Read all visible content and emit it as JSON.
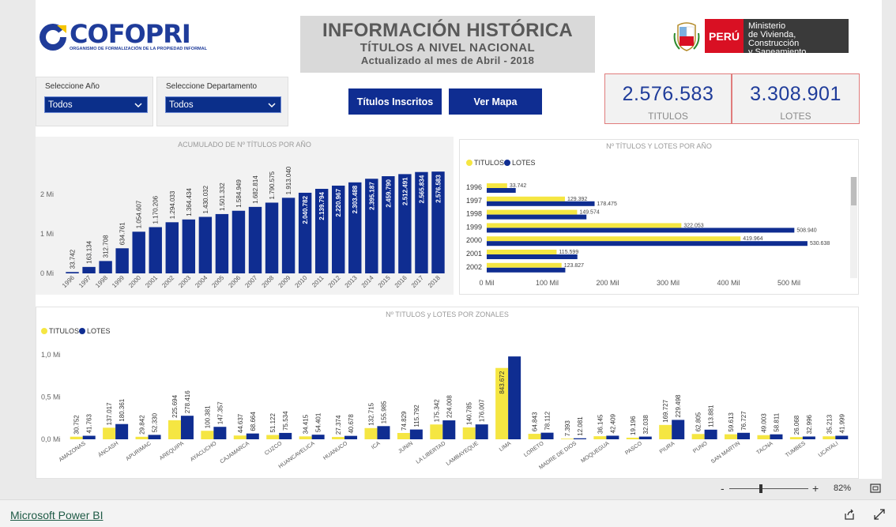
{
  "header": {
    "logo_brand": "COFOPRI",
    "logo_sub": "ORGANISMO DE FORMALIZACIÓN DE LA PROPIEDAD INFORMAL",
    "title_main": "INFORMACIÓN HISTÓRICA",
    "title_sub": "TÍTULOS A NIVEL NACIONAL",
    "title_date": "Actualizado al mes de Abril - 2018",
    "peru_label": "PERÚ",
    "ministry_line1": "Ministerio",
    "ministry_line2": "de Vivienda, Construcción",
    "ministry_line3": "y Saneamiento"
  },
  "filters": {
    "year_label": "Seleccione Año",
    "year_value": "Todos",
    "dept_label": "Seleccione Departamento",
    "dept_value": "Todos"
  },
  "buttons": {
    "titulos_inscritos": "Títulos Inscritos",
    "ver_mapa": "Ver Mapa"
  },
  "kpis": {
    "titulos_value": "2.576.583",
    "titulos_caption": "TITULOS",
    "lotes_value": "3.308.901",
    "lotes_caption": "LOTES"
  },
  "colors": {
    "navy": "#0f2d91",
    "yellow": "#f5e642",
    "kpi_border": "#e07c7c"
  },
  "zoom": {
    "minus": "-",
    "plus": "+",
    "level": "82%",
    "level_fraction": 0.4
  },
  "footer": {
    "powerbi_link": "Microsoft Power BI"
  },
  "chart_data": [
    {
      "type": "bar",
      "title": "ACUMULADO DE Nº TÍTULOS POR AÑO",
      "categories": [
        "1996",
        "1997",
        "1998",
        "1999",
        "2000",
        "2001",
        "2002",
        "2003",
        "2004",
        "2005",
        "2006",
        "2007",
        "2008",
        "2009",
        "2010",
        "2011",
        "2012",
        "2013",
        "2014",
        "2015",
        "2016",
        "2017",
        "2018"
      ],
      "values": [
        33742,
        163134,
        312708,
        634761,
        1054607,
        1170206,
        1294033,
        1364434,
        1430032,
        1501332,
        1584949,
        1682814,
        1790575,
        1913040,
        2040782,
        2139794,
        2220967,
        2303488,
        2395187,
        2459790,
        2512491,
        2565834,
        2576583
      ],
      "labels": [
        "33.742",
        "163.134",
        "312.708",
        "634.761",
        "1.054.607",
        "1.170.206",
        "1.294.033",
        "1.364.434",
        "1.430.032",
        "1.501.332",
        "1.584.949",
        "1.682.814",
        "1.790.575",
        "1.913.040",
        "2.040.782",
        "2.139.794",
        "2.220.967",
        "2.303.488",
        "2.395.187",
        "2.459.790",
        "2.512.491",
        "2.565.834",
        "2.576.583"
      ],
      "yticks": [
        "0 Mi",
        "1 Mi",
        "2 Mi"
      ],
      "ylim": [
        0,
        2800000
      ],
      "color": "#0f2d91"
    },
    {
      "type": "bar",
      "orientation": "horizontal",
      "title": "Nº TÍTULOS Y LOTES POR AÑO",
      "categories": [
        "1996",
        "1997",
        "1998",
        "1999",
        "2000",
        "2001",
        "2002"
      ],
      "series": [
        {
          "name": "TITULOS",
          "color": "#f5e642",
          "values": [
            33742,
            129392,
            149574,
            322053,
            419964,
            115599,
            123827
          ],
          "labels": [
            "33.742",
            "129.392",
            "149.574",
            "322.053",
            "419.964",
            "115.599",
            "123.827"
          ]
        },
        {
          "name": "LOTES",
          "color": "#0f2d91",
          "values": [
            48000,
            178475,
            165000,
            508940,
            530638,
            150000,
            130000
          ],
          "labels": [
            "",
            "178.475",
            "",
            "508.940",
            "530.638",
            "",
            ""
          ]
        }
      ],
      "xticks": [
        "0 Mil",
        "100 Mil",
        "200 Mil",
        "300 Mil",
        "400 Mil",
        "500 Mil"
      ],
      "xlim": [
        0,
        600000
      ],
      "legend": "top-left"
    },
    {
      "type": "bar",
      "title": "Nº TITULOS y LOTES POR ZONALES",
      "categories": [
        "AMAZONAS",
        "ÁNCASH",
        "APURIMAC",
        "AREQUIPA",
        "AYACUCHO",
        "CAJAMARCA",
        "CUZCO",
        "HUANCAVELICA",
        "HUANUCO",
        "ICA",
        "JUNIN",
        "LA LIBERTAD",
        "LAMBAYEQUE",
        "LIMA",
        "LORETO",
        "MADRE DE DIOS",
        "MOQUEGUA",
        "PASCO",
        "PIURA",
        "PUNO",
        "SAN MARTIN",
        "TACNA",
        "TUMBES",
        "UCAYALI"
      ],
      "series": [
        {
          "name": "TITULOS",
          "color": "#f5e642",
          "values": [
            30752,
            137017,
            29842,
            225694,
            100381,
            44637,
            51122,
            34415,
            27374,
            132715,
            74829,
            175342,
            140785,
            843672,
            64843,
            7393,
            36145,
            19196,
            169727,
            62805,
            59613,
            49003,
            26068,
            35213
          ],
          "labels": [
            "30.752",
            "137.017",
            "29.842",
            "225.694",
            "100.381",
            "44.637",
            "51.122",
            "34.415",
            "27.374",
            "132.715",
            "74.829",
            "175.342",
            "140.785",
            "843.672",
            "64.843",
            "7.393",
            "36.145",
            "19.196",
            "169.727",
            "62.805",
            "59.613",
            "49.003",
            "26.068",
            "35.213"
          ]
        },
        {
          "name": "LOTES",
          "color": "#0f2d91",
          "values": [
            41763,
            180361,
            52330,
            278416,
            147357,
            68664,
            75534,
            54401,
            40678,
            155985,
            115792,
            224008,
            176007,
            980000,
            78112,
            12081,
            42409,
            32038,
            229498,
            113881,
            76727,
            58811,
            32996,
            41999
          ],
          "labels": [
            "41.763",
            "180.361",
            "52.330",
            "278.416",
            "147.357",
            "68.664",
            "75.534",
            "54.401",
            "40.678",
            "155.985",
            "115.792",
            "224.008",
            "176.007",
            "",
            "78.112",
            "12.081",
            "42.409",
            "32.038",
            "229.498",
            "113.881",
            "76.727",
            "58.811",
            "32.996",
            "41.999"
          ]
        }
      ],
      "yticks": [
        "0,0 Mi",
        "0,5 Mi",
        "1,0 Mi"
      ],
      "ylim": [
        0,
        1000000
      ],
      "legend": "top-left"
    }
  ]
}
